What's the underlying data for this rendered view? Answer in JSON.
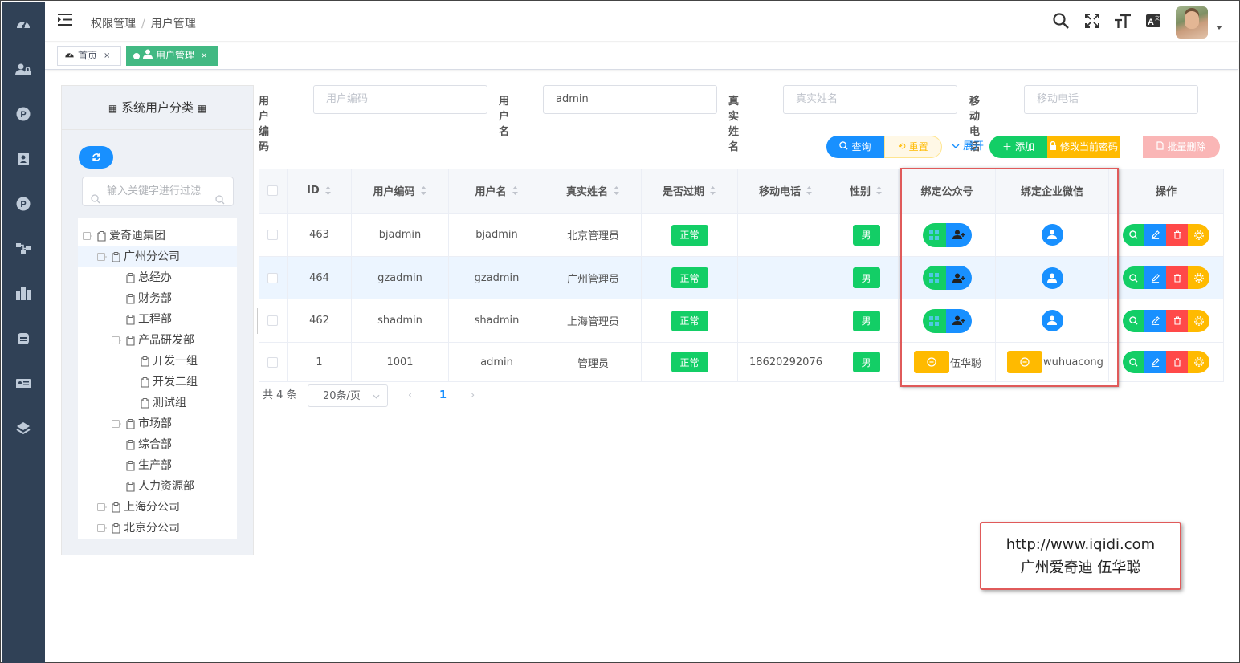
{
  "breadcrumb": {
    "parent": "权限管理",
    "separator": "/",
    "current": "用户管理"
  },
  "header_icons": [
    "search-icon",
    "fullscreen-icon",
    "font-size-icon",
    "translate-icon"
  ],
  "tabs": [
    {
      "label": "首页",
      "close": "×"
    },
    {
      "label": "用户管理",
      "close": "×",
      "active": true
    }
  ],
  "tree_panel": {
    "title": "系统用户分类",
    "filter_placeholder": "输入关键字进行过滤",
    "nodes": [
      {
        "label": "爱奇迪集团",
        "level": 0
      },
      {
        "label": "广州分公司",
        "level": 1,
        "selected": true
      },
      {
        "label": "总经办",
        "level": 2
      },
      {
        "label": "财务部",
        "level": 2
      },
      {
        "label": "工程部",
        "level": 2
      },
      {
        "label": "产品研发部",
        "level": 2
      },
      {
        "label": "开发一组",
        "level": 3
      },
      {
        "label": "开发二组",
        "level": 3
      },
      {
        "label": "测试组",
        "level": 3
      },
      {
        "label": "市场部",
        "level": 2
      },
      {
        "label": "综合部",
        "level": 2
      },
      {
        "label": "生产部",
        "level": 2
      },
      {
        "label": "人力资源部",
        "level": 2
      },
      {
        "label": "上海分公司",
        "level": 1
      },
      {
        "label": "北京分公司",
        "level": 1
      }
    ]
  },
  "search": {
    "user_code": {
      "label": "用户编码",
      "placeholder": "用户编码",
      "value": ""
    },
    "user_name": {
      "label": "用户名",
      "value": "admin"
    },
    "real_name": {
      "label": "真实姓名",
      "placeholder": "真实姓名",
      "value": ""
    },
    "mobile": {
      "label": "移动电话",
      "placeholder": "移动电话",
      "value": ""
    }
  },
  "buttons": {
    "query": "查询",
    "reset": "重置",
    "expand": "展开",
    "add": "添加",
    "change_password": "修改当前密码",
    "batch_delete": "批量删除"
  },
  "table": {
    "columns": [
      "ID",
      "用户编码",
      "用户名",
      "真实姓名",
      "是否过期",
      "移动电话",
      "性别",
      "绑定公众号",
      "绑定企业微信",
      "操作"
    ],
    "rows": [
      {
        "id": "463",
        "code": "bjadmin",
        "name": "bjadmin",
        "real_name": "北京管理员",
        "status": "正常",
        "mobile": "",
        "gender": "男",
        "wx_bound": true,
        "wx_name": "",
        "wecom_bound": true,
        "wecom_name": ""
      },
      {
        "id": "464",
        "code": "gzadmin",
        "name": "gzadmin",
        "real_name": "广州管理员",
        "status": "正常",
        "mobile": "",
        "gender": "男",
        "wx_bound": true,
        "wx_name": "",
        "wecom_bound": true,
        "wecom_name": ""
      },
      {
        "id": "462",
        "code": "shadmin",
        "name": "shadmin",
        "real_name": "上海管理员",
        "status": "正常",
        "mobile": "",
        "gender": "男",
        "wx_bound": true,
        "wx_name": "",
        "wecom_bound": true,
        "wecom_name": ""
      },
      {
        "id": "1",
        "code": "1001",
        "name": "admin",
        "real_name": "管理员",
        "status": "正常",
        "mobile": "18620292076",
        "gender": "男",
        "wx_bound": false,
        "wx_name": "伍华聪",
        "wecom_bound": false,
        "wecom_name": "wuhuacong"
      }
    ]
  },
  "pagination": {
    "total": "共 4 条",
    "page_size": "20条/页",
    "current_page": "1"
  },
  "note": {
    "line1": "http://www.iqidi.com",
    "line2": "广州爱奇迪 伍华聪"
  },
  "colors": {
    "primary": "#1890ff",
    "success": "#13ce66",
    "warning": "#ffba00",
    "danger": "#ff4949",
    "sidebar": "#304156",
    "tag_active": "#42b983"
  }
}
